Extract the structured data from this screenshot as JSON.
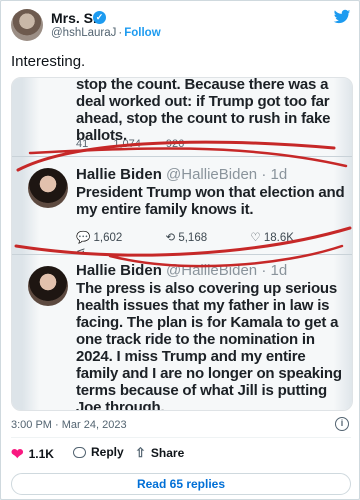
{
  "author": {
    "name": "Mrs. S.",
    "handle": "@hshLauraJ",
    "separator": "·",
    "follow_label": "Follow"
  },
  "tweet_text": "Interesting.",
  "embedded_screenshot": {
    "top_partial_text": "stop the count. Because there was a deal worked out: if Trump got too far ahead, stop the count to rush in fake ballots.",
    "top_partial_stats": [
      "41",
      "1,074",
      "926"
    ],
    "posts": [
      {
        "name": "Hallie Biden",
        "handle": "@HallieBiden",
        "age": "· 1d",
        "text": "President Trump won that election and my entire family knows it.",
        "replies": "1,602",
        "retweets": "5,168",
        "likes": "18.6K"
      },
      {
        "name": "Hallie Biden",
        "handle": "@HallieBiden",
        "age": "· 1d",
        "text": "The press is also covering up serious health issues that my father in law is facing. The plan is for Kamala to get a one track ride to the nomination in 2024. I miss Trump and my entire family and I are no longer on speaking terms because of what Jill is putting Joe through."
      }
    ]
  },
  "timestamp": "3:00 PM · Mar 24, 2023",
  "actions": {
    "likes": "1.1K",
    "reply_label": "Reply",
    "share_label": "Share"
  },
  "read_replies_label": "Read 65 replies",
  "colors": {
    "accent": "#1d9bf0",
    "like": "#f91880",
    "annotation_red": "#c62828"
  }
}
